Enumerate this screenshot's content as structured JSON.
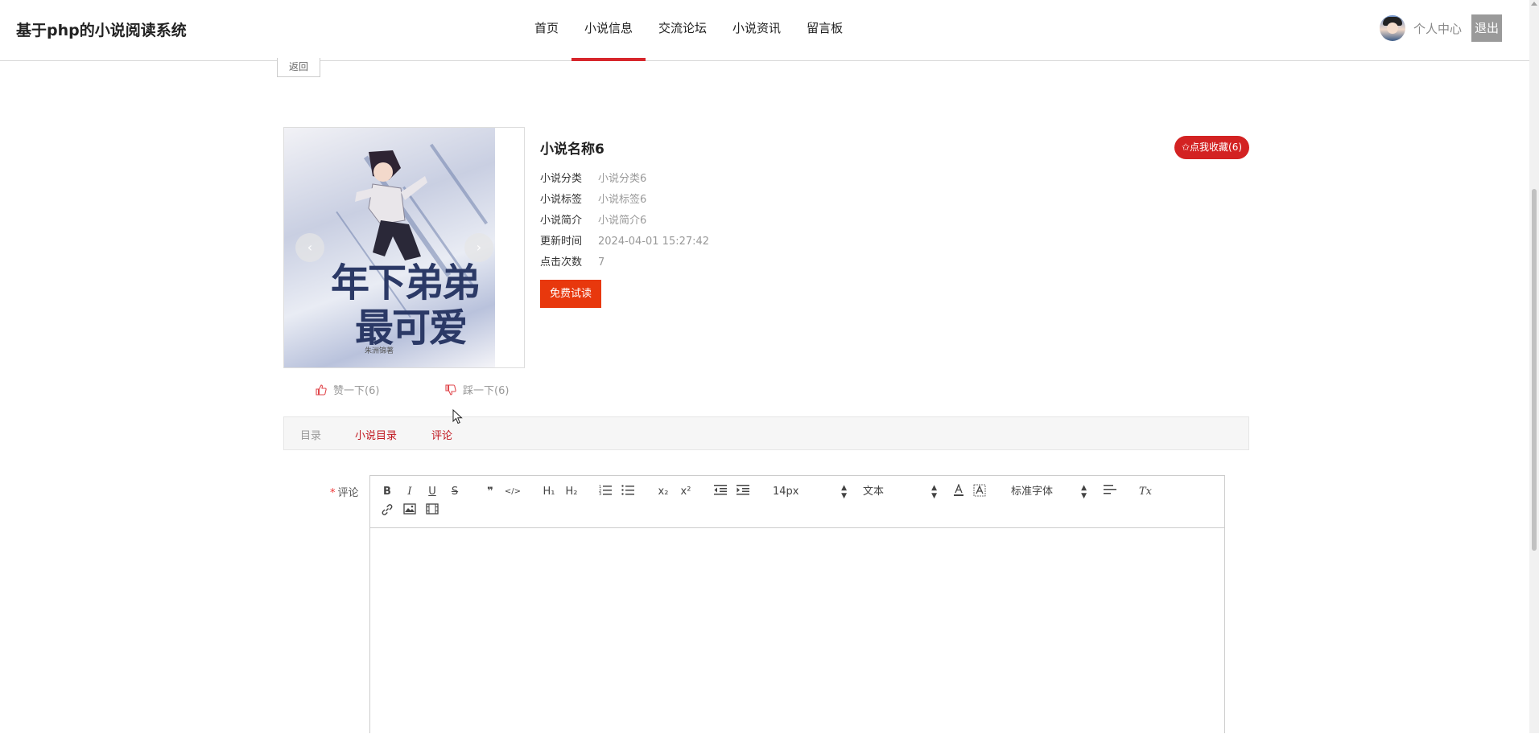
{
  "header": {
    "site_title": "基于php的小说阅读系统",
    "nav": [
      {
        "label": "首页",
        "active": false
      },
      {
        "label": "小说信息",
        "active": true
      },
      {
        "label": "交流论坛",
        "active": false
      },
      {
        "label": "小说资讯",
        "active": false
      },
      {
        "label": "留言板",
        "active": false
      }
    ],
    "user_center": "个人中心",
    "logout": "退出"
  },
  "back_button": "返回",
  "cover": {
    "title_line1": "年下弟弟",
    "title_line2": "最可爱",
    "author": "朱洲锦著",
    "prev": "‹",
    "next": "›"
  },
  "novel": {
    "name": "小说名称6",
    "fields": [
      {
        "label": "小说分类",
        "value": "小说分类6"
      },
      {
        "label": "小说标签",
        "value": "小说标签6"
      },
      {
        "label": "小说简介",
        "value": "小说简介6"
      },
      {
        "label": "更新时间",
        "value": "2024-04-01 15:27:42"
      },
      {
        "label": "点击次数",
        "value": "7"
      }
    ],
    "trial_button": "免费试读",
    "favorite_button": "✩点我收藏(6)"
  },
  "votes": {
    "like": "赞一下(6)",
    "dislike": "踩一下(6)"
  },
  "tabs": [
    "目录",
    "小说目录",
    "评论"
  ],
  "comment": {
    "required_mark": "*",
    "label": "评论",
    "toolbar": {
      "bold": "B",
      "italic": "I",
      "underline": "U",
      "strike": "S",
      "quote": "❞",
      "code": "</>",
      "h1": "H₁",
      "h2": "H₂",
      "subscript": "x₂",
      "superscript": "x²",
      "font_size": "14px",
      "text_type": "文本",
      "font_family": "标准字体",
      "clear_format": "Tx"
    }
  },
  "colors": {
    "accent": "#d7262c",
    "trial_button": "#e8380d",
    "favorite_button": "#d32222",
    "tab_active_text": "#c0161e"
  }
}
